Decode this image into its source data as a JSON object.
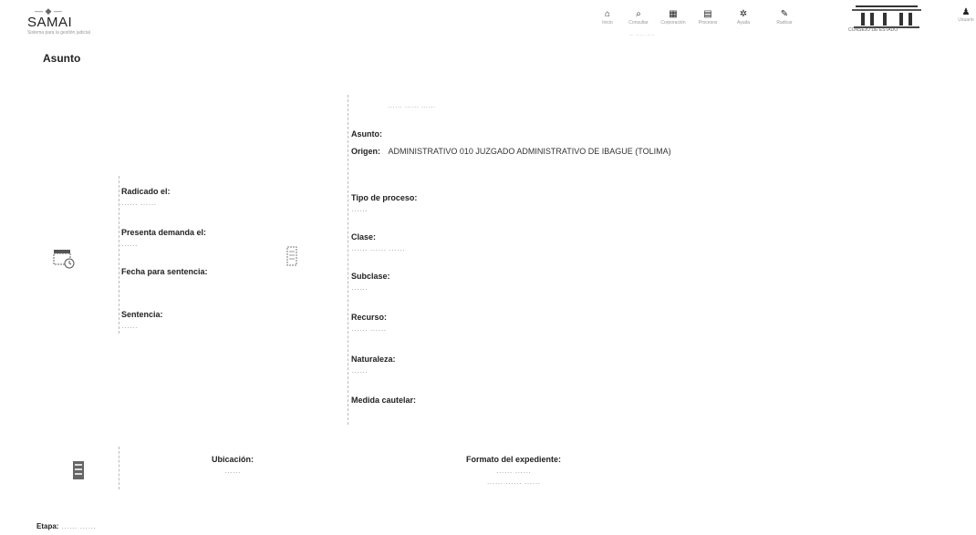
{
  "header": {
    "logo_small": "— ◆ —",
    "logo_name": "SAMAI",
    "logo_sub": "Sistema para la gestión judicial",
    "nav": [
      {
        "icon": "home-icon",
        "glyph": "⌂",
        "label": "Inicio"
      },
      {
        "icon": "search-icon",
        "glyph": "⌕",
        "label": "Consultar"
      },
      {
        "icon": "building-icon",
        "glyph": "▦",
        "label": "Corporación"
      },
      {
        "icon": "document-icon",
        "glyph": "▤",
        "label": "Procesos"
      },
      {
        "icon": "gear-icon",
        "glyph": "✲",
        "label": "Ayuda"
      },
      {
        "icon": "pen-icon",
        "glyph": "✎",
        "label": "Radicar"
      }
    ],
    "nav_subtext": "…  ……  ……",
    "user_label": "Usuario",
    "building_caption": "CONSEJO DE ESTADO"
  },
  "page": {
    "title": "Asunto"
  },
  "left_panel": {
    "radicado_label": "Radicado el:",
    "radicado_value": "…… ……",
    "presenta_label": "Presenta demanda el:",
    "presenta_value": "……",
    "fecha_label": "Fecha para sentencia:",
    "fecha_value": "",
    "sentencia_label": "Sentencia:",
    "sentencia_value": "……"
  },
  "right_panel": {
    "top_blur": "…… …… ……",
    "asunto_label": "Asunto:",
    "origen_label": "Origen:",
    "origen_value": "ADMINISTRATIVO 010 JUZGADO ADMINISTRATIVO DE IBAGUE (TOLIMA)",
    "fields": [
      {
        "label": "Tipo de proceso:",
        "value": "……"
      },
      {
        "label": "Clase:",
        "value": "…… …… ……"
      },
      {
        "label": "Subclase:",
        "value": "……"
      },
      {
        "label": "Recurso:",
        "value": "…… ……"
      },
      {
        "label": "Naturaleza:",
        "value": "……"
      },
      {
        "label": "Medida cautelar:",
        "value": ""
      }
    ]
  },
  "bottom": {
    "ubicacion_label": "Ubicación:",
    "ubicacion_value": "……",
    "formato_label": "Formato del expediente:",
    "formato_line1": "…… ……",
    "formato_line2": "…… …… ……",
    "etapa_label": "Etapa:",
    "etapa_value": "…… ……"
  }
}
